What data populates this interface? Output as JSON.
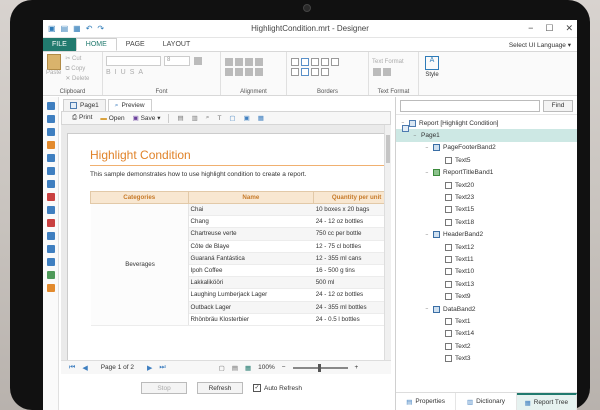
{
  "window": {
    "title": "HighlightCondition.mrt - Designer"
  },
  "ribbon": {
    "tabs": [
      {
        "label": "FILE"
      },
      {
        "label": "HOME"
      },
      {
        "label": "PAGE"
      },
      {
        "label": "LAYOUT"
      }
    ],
    "language": "Select UI Language ▾",
    "clipboard": {
      "paste": "Paste",
      "cut": "Cut",
      "copy": "Copy",
      "delete": "Delete",
      "label": "Clipboard"
    },
    "font_label": "Font",
    "font_size": "8",
    "alignment_label": "Alignment",
    "borders_label": "Borders",
    "text_format": {
      "top": "Text Format",
      "bottom": "Text Format"
    },
    "style_label": "Style"
  },
  "doc_tabs": [
    {
      "label": "Page1"
    },
    {
      "label": "Preview"
    }
  ],
  "preview_toolbar": {
    "print": "Print",
    "open": "Open",
    "save": "Save"
  },
  "report": {
    "title": "Highlight Condition",
    "description": "This sample demonstrates how to use highlight condition to create a report.",
    "columns": [
      "Categories",
      "Name",
      "Quantity per unit"
    ],
    "category": "Beverages",
    "rows": [
      {
        "name": "Chai",
        "qty": "10 boxes x 20 bags"
      },
      {
        "name": "Chang",
        "qty": "24 - 12 oz bottles"
      },
      {
        "name": "Chartreuse verte",
        "qty": "750 cc per bottle"
      },
      {
        "name": "Côte de Blaye",
        "qty": "12 - 75 cl bottles"
      },
      {
        "name": "Guaraná Fantástica",
        "qty": "12 - 355 ml cans"
      },
      {
        "name": "Ipoh Coffee",
        "qty": "16 - 500 g tins"
      },
      {
        "name": "Lakkalikööri",
        "qty": "500 ml"
      },
      {
        "name": "Laughing Lumberjack Lager",
        "qty": "24 - 12 oz bottles"
      },
      {
        "name": "Outback Lager",
        "qty": "24 - 355 ml bottles"
      },
      {
        "name": "Rhönbräu Klosterbier",
        "qty": "24 - 0.5 l bottles"
      }
    ]
  },
  "navigation": {
    "page_info": "Page 1 of 2",
    "zoom": "100%"
  },
  "actions": {
    "stop": "Stop",
    "refresh": "Refresh",
    "auto_refresh": "Auto Refresh",
    "auto_refresh_checked": true
  },
  "search": {
    "button": "Find"
  },
  "tree": [
    {
      "label": "Report [Highlight Condition]",
      "level": 0,
      "toggle": "−",
      "icon": "report"
    },
    {
      "label": "Page1",
      "level": 1,
      "toggle": "−",
      "icon": "page",
      "selected": true
    },
    {
      "label": "PageFooterBand2",
      "level": 2,
      "toggle": "−",
      "icon": "band"
    },
    {
      "label": "Text5",
      "level": 3,
      "toggle": "",
      "icon": "txt"
    },
    {
      "label": "ReportTitleBand1",
      "level": 2,
      "toggle": "−",
      "icon": "green"
    },
    {
      "label": "Text20",
      "level": 3,
      "toggle": "",
      "icon": "txt"
    },
    {
      "label": "Text23",
      "level": 3,
      "toggle": "",
      "icon": "txt"
    },
    {
      "label": "Text15",
      "level": 3,
      "toggle": "",
      "icon": "txt"
    },
    {
      "label": "Text18",
      "level": 3,
      "toggle": "",
      "icon": "txt"
    },
    {
      "label": "HeaderBand2",
      "level": 2,
      "toggle": "−",
      "icon": "band"
    },
    {
      "label": "Text12",
      "level": 3,
      "toggle": "",
      "icon": "txt"
    },
    {
      "label": "Text11",
      "level": 3,
      "toggle": "",
      "icon": "txt"
    },
    {
      "label": "Text10",
      "level": 3,
      "toggle": "",
      "icon": "txt"
    },
    {
      "label": "Text13",
      "level": 3,
      "toggle": "",
      "icon": "txt"
    },
    {
      "label": "Text9",
      "level": 3,
      "toggle": "",
      "icon": "txt"
    },
    {
      "label": "DataBand2",
      "level": 2,
      "toggle": "−",
      "icon": "band"
    },
    {
      "label": "Text1",
      "level": 3,
      "toggle": "",
      "icon": "txt"
    },
    {
      "label": "Text14",
      "level": 3,
      "toggle": "",
      "icon": "txt"
    },
    {
      "label": "Text2",
      "level": 3,
      "toggle": "",
      "icon": "txt"
    },
    {
      "label": "Text3",
      "level": 3,
      "toggle": "",
      "icon": "txt"
    }
  ],
  "panel_tabs": [
    {
      "label": "Properties"
    },
    {
      "label": "Dictionary"
    },
    {
      "label": "Report Tree"
    }
  ],
  "colors": {
    "accent": "#217a6e",
    "report_title": "#e0832a",
    "header_bg": "#f8e7d1"
  }
}
